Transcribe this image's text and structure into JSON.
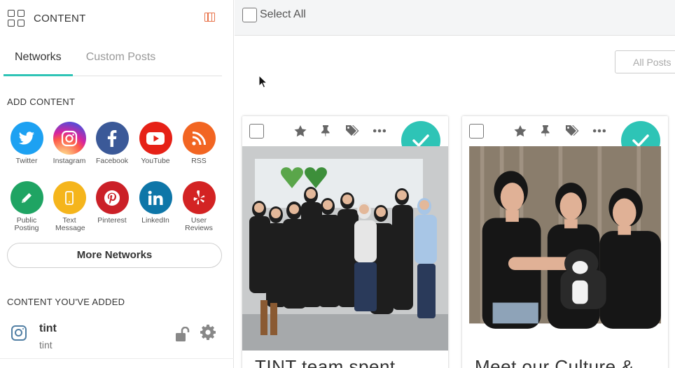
{
  "sidebar": {
    "title": "CONTENT",
    "tabs": [
      {
        "label": "Networks",
        "active": true
      },
      {
        "label": "Custom Posts",
        "active": false
      }
    ],
    "add_content_title": "ADD CONTENT",
    "networks": [
      {
        "label": "Twitter",
        "icon": "twitter-icon",
        "color": "#1da1f2"
      },
      {
        "label": "Instagram",
        "icon": "instagram-icon",
        "color": "#c13584"
      },
      {
        "label": "Facebook",
        "icon": "facebook-icon",
        "color": "#3b5998"
      },
      {
        "label": "YouTube",
        "icon": "youtube-icon",
        "color": "#e62117"
      },
      {
        "label": "RSS",
        "icon": "rss-icon",
        "color": "#f26522"
      },
      {
        "label": "Public Posting",
        "icon": "pencil-icon",
        "color": "#1fa463"
      },
      {
        "label": "Text Message",
        "icon": "phone-icon",
        "color": "#f5b51c"
      },
      {
        "label": "Pinterest",
        "icon": "pinterest-icon",
        "color": "#cb2027"
      },
      {
        "label": "LinkedIn",
        "icon": "linkedin-icon",
        "color": "#0e76a8"
      },
      {
        "label": "User Reviews",
        "icon": "yelp-icon",
        "color": "#d32323"
      }
    ],
    "more_networks": "More Networks",
    "added_title": "CONTENT YOU'VE ADDED",
    "sources": [
      {
        "name": "tint",
        "sub": "tint",
        "icon": "instagram-icon"
      }
    ]
  },
  "main": {
    "select_all": "Select All",
    "filter_label": "All Posts",
    "accent": "#2ec4b6",
    "posts": [
      {
        "text": "TINT team spent",
        "approved": true
      },
      {
        "text": "Meet our Culture &",
        "approved": true
      }
    ]
  }
}
